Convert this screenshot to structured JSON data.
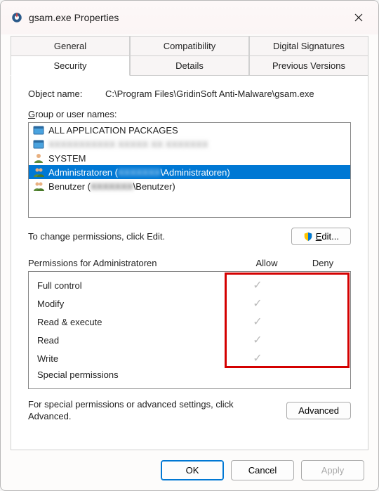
{
  "titlebar": {
    "title": "gsam.exe Properties"
  },
  "tabs": {
    "row1": [
      "General",
      "Compatibility",
      "Digital Signatures"
    ],
    "row2": [
      "Security",
      "Details",
      "Previous Versions"
    ],
    "active": "Security"
  },
  "object": {
    "label": "Object name:",
    "path": "C:\\Program Files\\GridinSoft Anti-Malware\\gsam.exe"
  },
  "groups": {
    "label": "Group or user names:",
    "items": [
      {
        "name": "ALL APPLICATION PACKAGES",
        "icon": "package",
        "selected": false,
        "blurred": false
      },
      {
        "name": "XXXXXXXXXXX XXXXX XX XXXXXXX",
        "icon": "package",
        "selected": false,
        "blurred": true
      },
      {
        "name": "SYSTEM",
        "icon": "user",
        "selected": false,
        "blurred": false
      },
      {
        "name": "Administratoren (",
        "name_suffix": "\\Administratoren)",
        "mid_blur": "XXXXXXX",
        "icon": "users",
        "selected": true,
        "blurred": false
      },
      {
        "name": "Benutzer (",
        "name_suffix": "\\Benutzer)",
        "mid_blur": "XXXXXXX",
        "icon": "users",
        "selected": false,
        "blurred": false
      }
    ]
  },
  "editrow": {
    "text": "To change permissions, click Edit.",
    "button": "Edit..."
  },
  "perms": {
    "header": "Permissions for Administratoren",
    "allow": "Allow",
    "deny": "Deny",
    "rows": [
      {
        "name": "Full control",
        "allow": true,
        "deny": false
      },
      {
        "name": "Modify",
        "allow": true,
        "deny": false
      },
      {
        "name": "Read & execute",
        "allow": true,
        "deny": false
      },
      {
        "name": "Read",
        "allow": true,
        "deny": false
      },
      {
        "name": "Write",
        "allow": true,
        "deny": false
      },
      {
        "name": "Special permissions",
        "allow": false,
        "deny": false
      }
    ]
  },
  "advrow": {
    "text": "For special permissions or advanced settings, click Advanced.",
    "button": "Advanced"
  },
  "footer": {
    "ok": "OK",
    "cancel": "Cancel",
    "apply": "Apply"
  }
}
